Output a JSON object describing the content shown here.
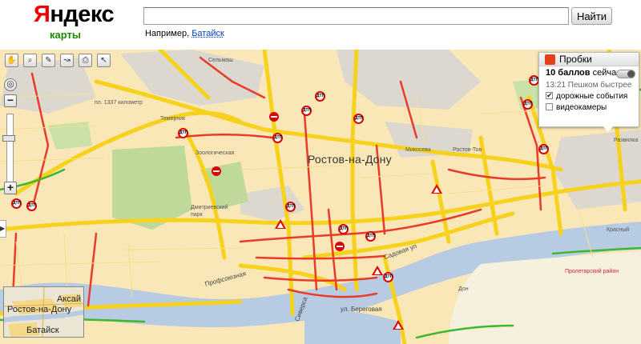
{
  "header": {
    "logo_first": "Я",
    "logo_rest": "ндекс",
    "service": "карты",
    "search_value": "",
    "search_button": "Найти",
    "example_prefix": "Например,",
    "example_link": "Батайск"
  },
  "toolbar": {
    "tools": [
      {
        "name": "hand-tool-button",
        "glyph": "✋"
      },
      {
        "name": "magnifier-tool-button",
        "glyph": "⌕"
      },
      {
        "name": "ruler-tool-button",
        "glyph": "✎"
      },
      {
        "name": "route-tool-button",
        "glyph": "↝"
      },
      {
        "name": "print-tool-button",
        "glyph": "⎙"
      },
      {
        "name": "cursor-tool-button",
        "glyph": "↖"
      }
    ],
    "zoom_in": "+",
    "zoom_out": "−",
    "pan_arrow": "▶"
  },
  "traffic": {
    "title": "Пробки",
    "score": "10 баллов",
    "now": "сейчас",
    "time_note": "13:21 Пешком быстрее",
    "events_label": "дорожные события",
    "events_checked": true,
    "cameras_label": "видеокамеры",
    "cameras_checked": false
  },
  "map": {
    "city_name": "Ростов-на-Дону",
    "labels": [
      "пл. 1337 километр",
      "Темерник",
      "Дмитриевский парк",
      "Сельмаш",
      "Микосева",
      "Ростов-Тов",
      "Развилка",
      "Красный",
      "Пролетарский район",
      "Профсоюзная",
      "ул. Береговая",
      "Садовая ул",
      "Сиверса",
      "Зоологическая",
      "Дон"
    ],
    "dtp_label": "ДТП",
    "minimap": {
      "city": "Ростов-на-Дону",
      "north": "Аксай",
      "south": "Батайск"
    }
  },
  "colors": {
    "road_yellow": "#f7d21c",
    "jam_red": "#e83b2a",
    "free_green": "#3fb82e",
    "land": "#f9e7b8",
    "water": "#b7cbe3",
    "park": "#bfd99a",
    "industrial": "#d9d5cc"
  }
}
